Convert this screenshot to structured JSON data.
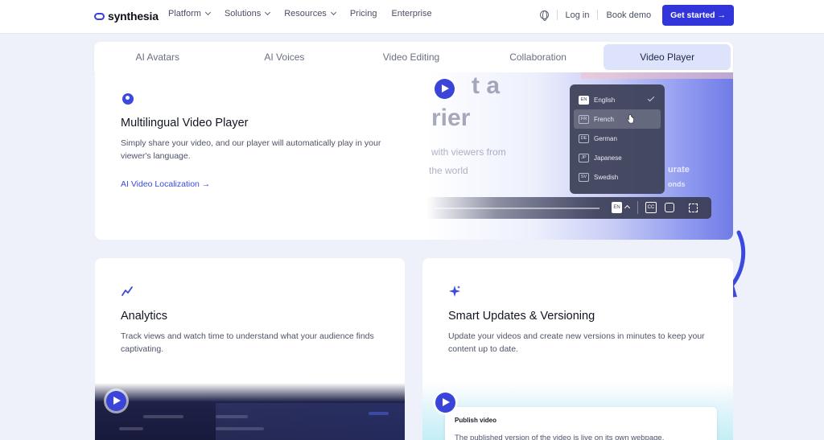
{
  "nav": {
    "brand": "synthesia",
    "links": [
      "Platform",
      "Solutions",
      "Resources",
      "Pricing",
      "Enterprise"
    ],
    "login": "Log in",
    "demo": "Book demo",
    "cta": "Get started →"
  },
  "tabs": [
    "AI Avatars",
    "AI Voices",
    "Video Editing",
    "Collaboration",
    "Video Player"
  ],
  "active_tab": "Video Player",
  "feature": {
    "title": "Multilingual Video Player",
    "description": "Simply share your video, and our player will automatically play in your viewer's language.",
    "link": "AI Video Localization →"
  },
  "player": {
    "bg_text_1": "t a",
    "bg_text_2": "rier",
    "bg_text_3": "with viewers from",
    "bg_text_4": "the world",
    "bg_text_5": "urate",
    "bg_text_6": "onds",
    "languages": [
      {
        "code": "EN",
        "name": "English"
      },
      {
        "code": "FR",
        "name": "French"
      },
      {
        "code": "DE",
        "name": "German"
      },
      {
        "code": "JP",
        "name": "Japanese"
      },
      {
        "code": "SV",
        "name": "Swedish"
      }
    ],
    "selected_language": "English",
    "hovered_language": "French",
    "caption_lang": "EN",
    "cc_label": "CC"
  },
  "analytics": {
    "title": "Analytics",
    "description": "Track views and watch time to understand what your audience finds captivating."
  },
  "versioning": {
    "title": "Smart Updates & Versioning",
    "description": "Update your videos and create new versions in minutes to keep your content up to date.",
    "publish_title": "Publish video",
    "publish_desc": "The published version of the video is live on its own webpage."
  },
  "colors": {
    "accent": "#3235d9",
    "link": "#3b49df",
    "page_bg": "#eef1f9",
    "active_tab_bg": "#dde3fb"
  }
}
